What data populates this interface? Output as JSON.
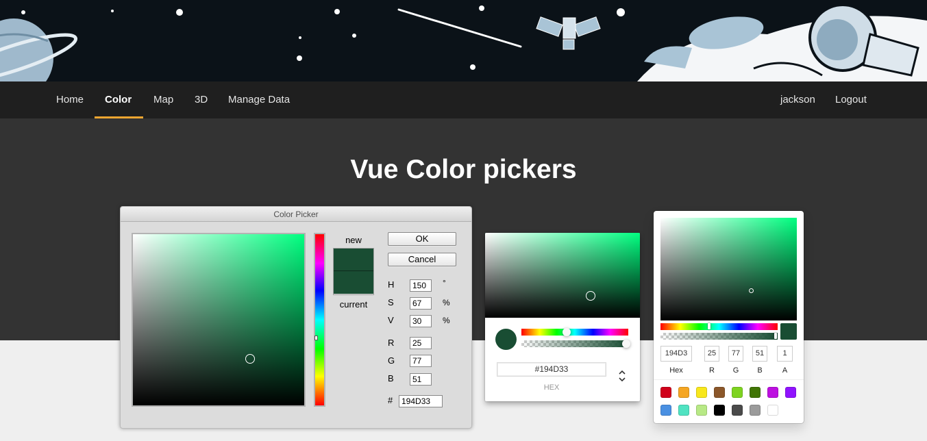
{
  "nav": {
    "items": [
      "Home",
      "Color",
      "Map",
      "3D",
      "Manage Data"
    ],
    "active": "Color",
    "user": "jackson",
    "logout": "Logout"
  },
  "page": {
    "title": "Vue Color pickers"
  },
  "photoshop": {
    "title": "Color Picker",
    "new_label": "new",
    "current_label": "current",
    "ok": "OK",
    "cancel": "Cancel",
    "fields": {
      "H": "150",
      "S": "67",
      "V": "30",
      "R": "25",
      "G": "77",
      "B": "51",
      "deg": "°",
      "pct": "%",
      "hash": "#",
      "hex": "194D33"
    }
  },
  "chrome": {
    "hex": "#194D33",
    "hex_label": "HEX",
    "toggle": "⌃\n⌄"
  },
  "sketch": {
    "hex": "194D3",
    "r": "25",
    "g": "77",
    "b": "51",
    "a": "1",
    "labels": {
      "hex": "Hex",
      "r": "R",
      "g": "G",
      "b": "B",
      "a": "A"
    },
    "presets": [
      "#D0021B",
      "#F5A623",
      "#F8E71C",
      "#8B572A",
      "#7ED321",
      "#417505",
      "#BD10E0",
      "#9013FE",
      "#4A90E2",
      "#50E3C2",
      "#B8E986",
      "#000000",
      "#4A4A4A",
      "#9B9B9B",
      "#FFFFFF"
    ]
  },
  "colors": {
    "current": "#194D33",
    "accent": "#F0A630",
    "navbar": "#1F1F1F",
    "hero": "#333333"
  }
}
